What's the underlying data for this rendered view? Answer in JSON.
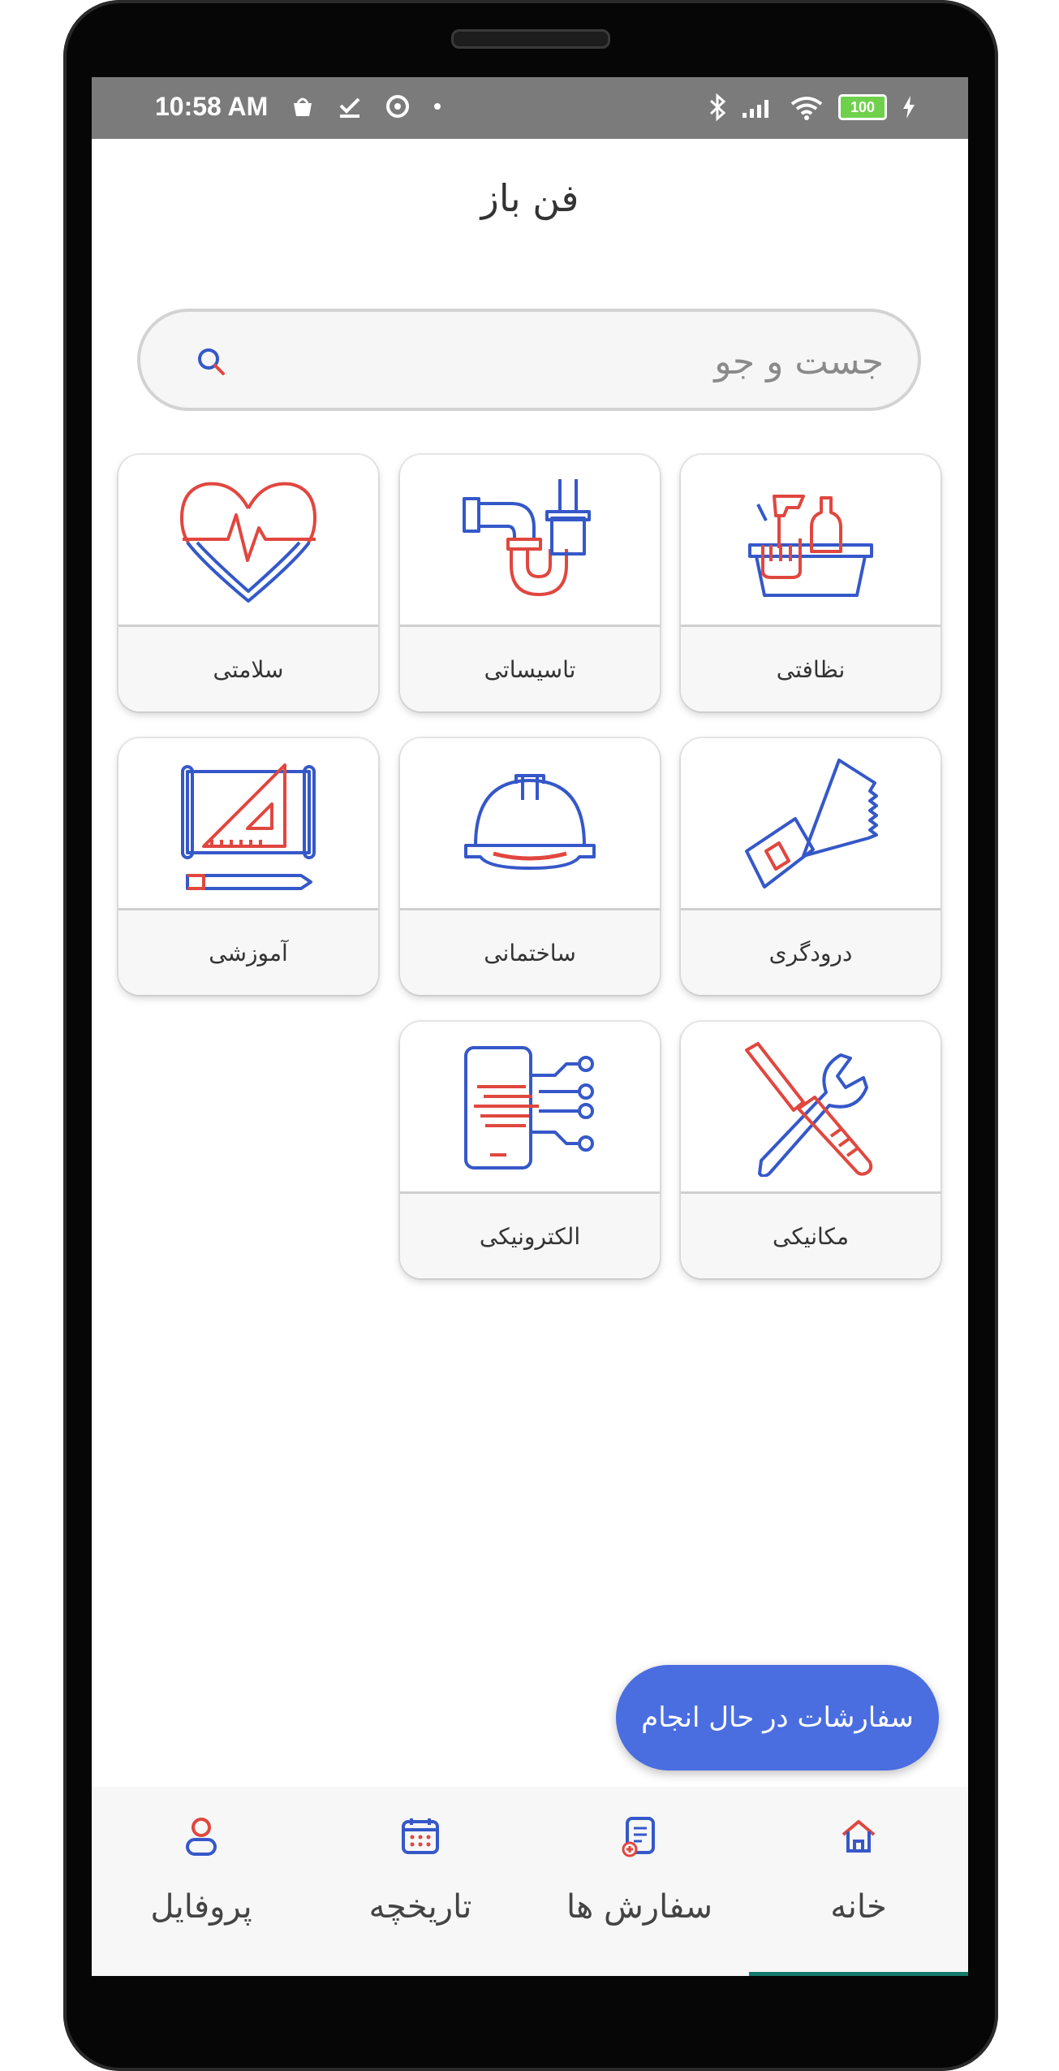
{
  "status": {
    "time": "10:58 AM",
    "battery": "100"
  },
  "app": {
    "title": "فن باز"
  },
  "search": {
    "placeholder": "جست و جو"
  },
  "categories": [
    {
      "label": "نظافتی",
      "icon": "cleaning-icon"
    },
    {
      "label": "تاسیساتی",
      "icon": "plumbing-icon"
    },
    {
      "label": "سلامتی",
      "icon": "health-icon"
    },
    {
      "label": "درودگری",
      "icon": "saw-icon"
    },
    {
      "label": "ساختمانی",
      "icon": "hardhat-icon"
    },
    {
      "label": "آموزشی",
      "icon": "education-icon"
    },
    {
      "label": "مکانیکی",
      "icon": "tools-icon"
    },
    {
      "label": "الکترونیکی",
      "icon": "electronics-icon"
    }
  ],
  "fab": {
    "label": "سفارشات در حال انجام"
  },
  "nav": {
    "items": [
      {
        "label": "خانه",
        "icon": "home-icon",
        "active": true
      },
      {
        "label": "سفارش ها",
        "icon": "orders-icon"
      },
      {
        "label": "تاریخچه",
        "icon": "calendar-icon"
      },
      {
        "label": "پروفایل",
        "icon": "profile-icon"
      }
    ]
  },
  "colors": {
    "accent": "#4a6ee0",
    "iconBlue": "#3558c9",
    "iconRed": "#e0473f",
    "statusbar": "#7b7b7b",
    "navIndicator": "#137b6b"
  }
}
